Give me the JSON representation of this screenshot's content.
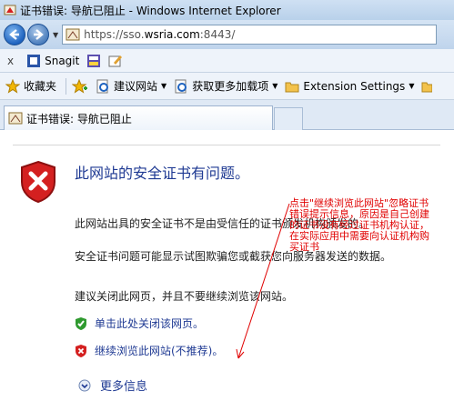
{
  "window": {
    "title": "证书错误: 导航已阻止 - Windows Internet Explorer"
  },
  "address": {
    "url_prefix": "https://sso.",
    "url_host": "wsria.com",
    "url_suffix": ":8443/"
  },
  "links_bar": {
    "close": "x",
    "snagit": "Snagit"
  },
  "favorites_bar": {
    "favorites": "收藏夹",
    "suggested": "建议网站",
    "addons": "获取更多加载项",
    "extension": "Extension Settings"
  },
  "tab": {
    "label": "证书错误: 导航已阻止"
  },
  "page": {
    "heading": "此网站的安全证书有问题。",
    "p1": "此网站出具的安全证书不是由受信任的证书颁发机构颁发的。",
    "p2": "安全证书问题可能显示试图欺骗您或截获您向服务器发送的数据。",
    "p3": "建议关闭此网页，并且不要继续浏览该网站。",
    "close_link": "单击此处关闭该网页。",
    "continue_link": "继续浏览此网站(不推荐)。",
    "more_info": "更多信息"
  },
  "annotation": {
    "lines": [
      "点击\"继续浏览此网站\"忽略证书",
      "错误提示信息，原因是自己创建",
      "的证书没有经过证书机构认证，",
      "在实际应用中需要向认证机构购",
      "买证书"
    ]
  },
  "colors": {
    "link": "#1f3a93",
    "annotation": "#e00000",
    "shield_red": "#d42020",
    "shield_green": "#2f9a2f"
  }
}
